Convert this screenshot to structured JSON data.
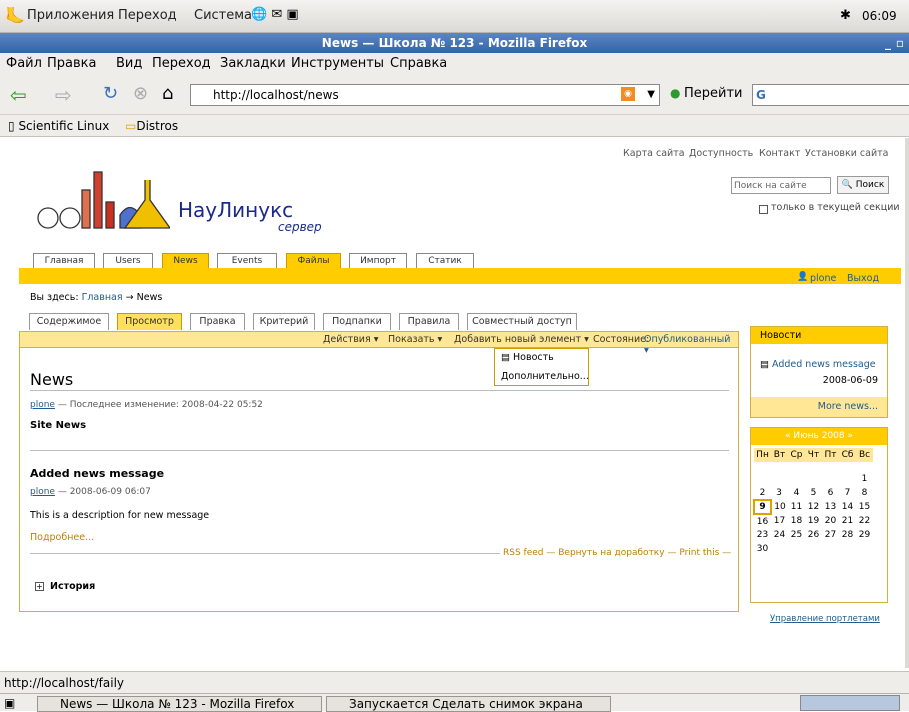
{
  "panel": {
    "apps": "Приложения",
    "places": "Переход",
    "system": "Система",
    "clock": "06:09"
  },
  "window": {
    "title": "News — Школа № 123 - Mozilla Firefox"
  },
  "menubar": {
    "file": "Файл",
    "edit": "Правка",
    "view": "Вид",
    "go": "Переход",
    "bookmarks": "Закладки",
    "tools": "Инструменты",
    "help": "Справка"
  },
  "nav": {
    "url": "http://localhost/news",
    "go_label": "Перейти",
    "search_engine": "G"
  },
  "bookmarks": {
    "item1": "Scientific Linux",
    "item2": "Distros"
  },
  "site": {
    "actions": [
      "Карта сайта",
      "Доступность",
      "Контакт",
      "Установки сайта"
    ],
    "logo_text": "НауЛинукс",
    "logo_sub": "сервер",
    "search_placeholder": "Поиск на сайте",
    "search_button": "Поиск",
    "search_section": "только в текущей секции",
    "tabs": [
      "Главная",
      "Users",
      "News",
      "Events",
      "Файлы",
      "Импорт",
      "Статик"
    ],
    "user": "plone",
    "logout": "Выход",
    "breadcrumb_prefix": "Вы здесь:",
    "breadcrumb_home": "Главная",
    "breadcrumb_arrow": "→",
    "breadcrumb_current": "News"
  },
  "content_tabs": [
    "Содержимое",
    "Просмотр",
    "Правка",
    "Критерий",
    "Подпапки",
    "Правила",
    "Совместный доступ"
  ],
  "actionbar": {
    "actions": "Действия ▾",
    "display": "Показать ▾",
    "add": "Добавить новый элемент ▾",
    "state_label": "Состояние:",
    "state_value": "Опубликованный ▾"
  },
  "add_menu": {
    "news": "Новость",
    "more": "Дополнительно..."
  },
  "page": {
    "title": "News",
    "author": "plone",
    "modified": "— Последнее изменение: 2008-04-22 05:52",
    "description": "Site News",
    "item_title": "Added news message",
    "item_author": "plone",
    "item_date": "— 2008-06-09 06:07",
    "item_desc": "This is a description for new message",
    "read_more": "Подробнее...",
    "footer_rss": "RSS feed",
    "footer_sep1": "—",
    "footer_reject": "Вернуть на доработку",
    "footer_sep2": "—",
    "footer_print": "Print this",
    "footer_sep3": "—",
    "history": "История"
  },
  "news_portlet": {
    "header": "Новости",
    "item": "Added news message",
    "date": "2008-06-09",
    "more": "More news..."
  },
  "calendar": {
    "title": "« Июнь 2008 »",
    "days": [
      "Пн",
      "Вт",
      "Ср",
      "Чт",
      "Пт",
      "Сб",
      "Вс"
    ],
    "weeks": [
      [
        "",
        "",
        "",
        "",
        "",
        "",
        "1"
      ],
      [
        "2",
        "3",
        "4",
        "5",
        "6",
        "7",
        "8"
      ],
      [
        "9",
        "10",
        "11",
        "12",
        "13",
        "14",
        "15"
      ],
      [
        "16",
        "17",
        "18",
        "19",
        "20",
        "21",
        "22"
      ],
      [
        "23",
        "24",
        "25",
        "26",
        "27",
        "28",
        "29"
      ],
      [
        "30",
        "",
        "",
        "",
        "",
        "",
        ""
      ]
    ],
    "today": "9"
  },
  "portlet_manage": "Управление портлетами",
  "status": {
    "url": "http://localhost/faily"
  },
  "taskbar": {
    "task1": "News — Школа № 123 - Mozilla Firefox",
    "task2": "Запускается Сделать снимок экрана"
  }
}
